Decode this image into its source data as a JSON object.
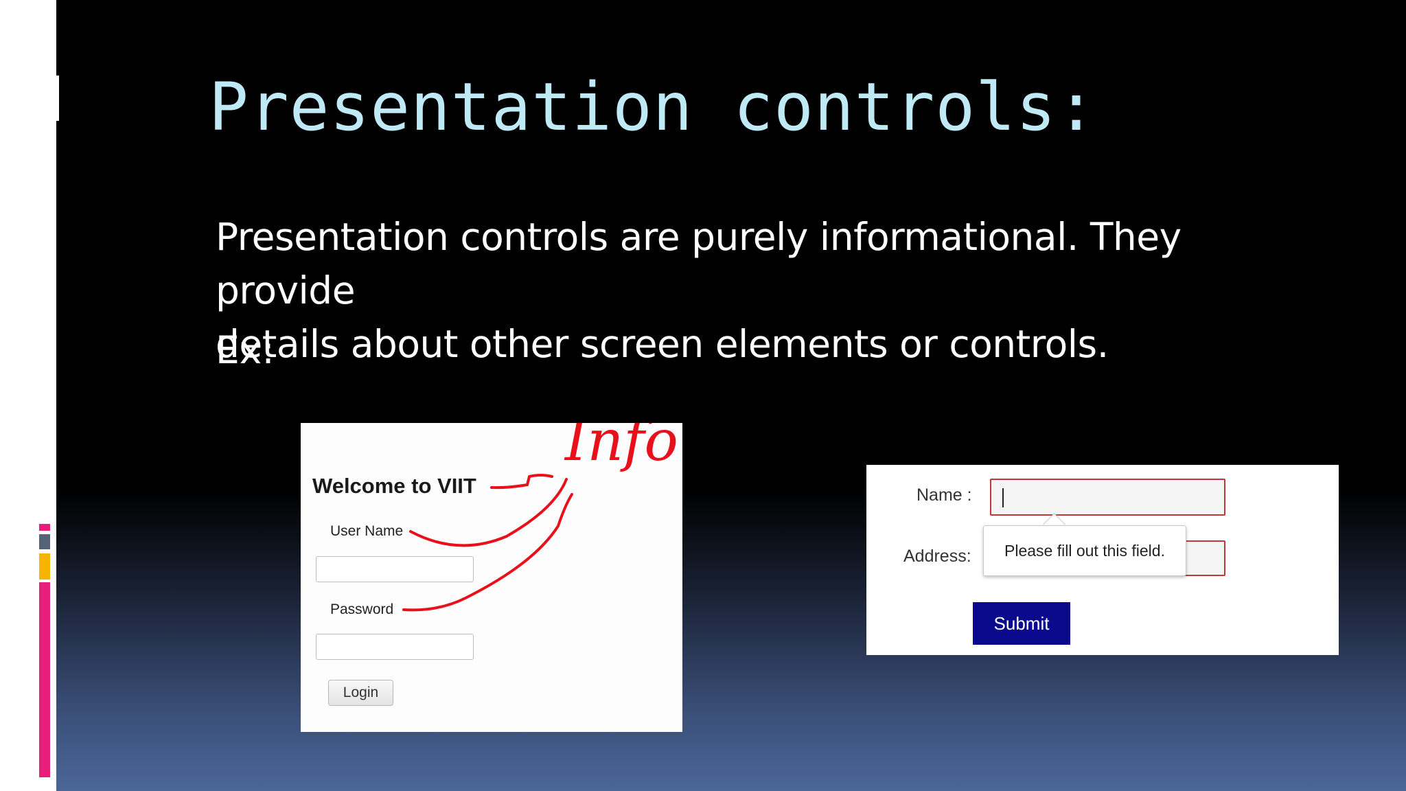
{
  "slide": {
    "title": "Presentation controls:",
    "body": [
      "Presentation controls are purely informational. They provide",
      "details about other screen elements or controls."
    ],
    "ex_label": "Ex:"
  },
  "example1": {
    "welcome": "Welcome to VIIT",
    "username_label": "User Name",
    "username_value": "",
    "password_label": "Password",
    "password_value": "",
    "login_button": "Login",
    "annotation_text": "Info"
  },
  "example2": {
    "name_label": "Name :",
    "name_value": "",
    "address_label": "Address:",
    "address_value": "",
    "tooltip": "Please fill out this field.",
    "submit_button": "Submit"
  },
  "colors": {
    "title": "#bfeaf5",
    "annotation_red": "#e8101a",
    "submit_bg": "#0b0a8c",
    "input_error_border": "#c7343a",
    "accent_pink": "#e91e7a",
    "accent_yellow": "#f5b400",
    "accent_slate": "#56617a"
  },
  "icons": [
    "slide-decoration-icon"
  ]
}
